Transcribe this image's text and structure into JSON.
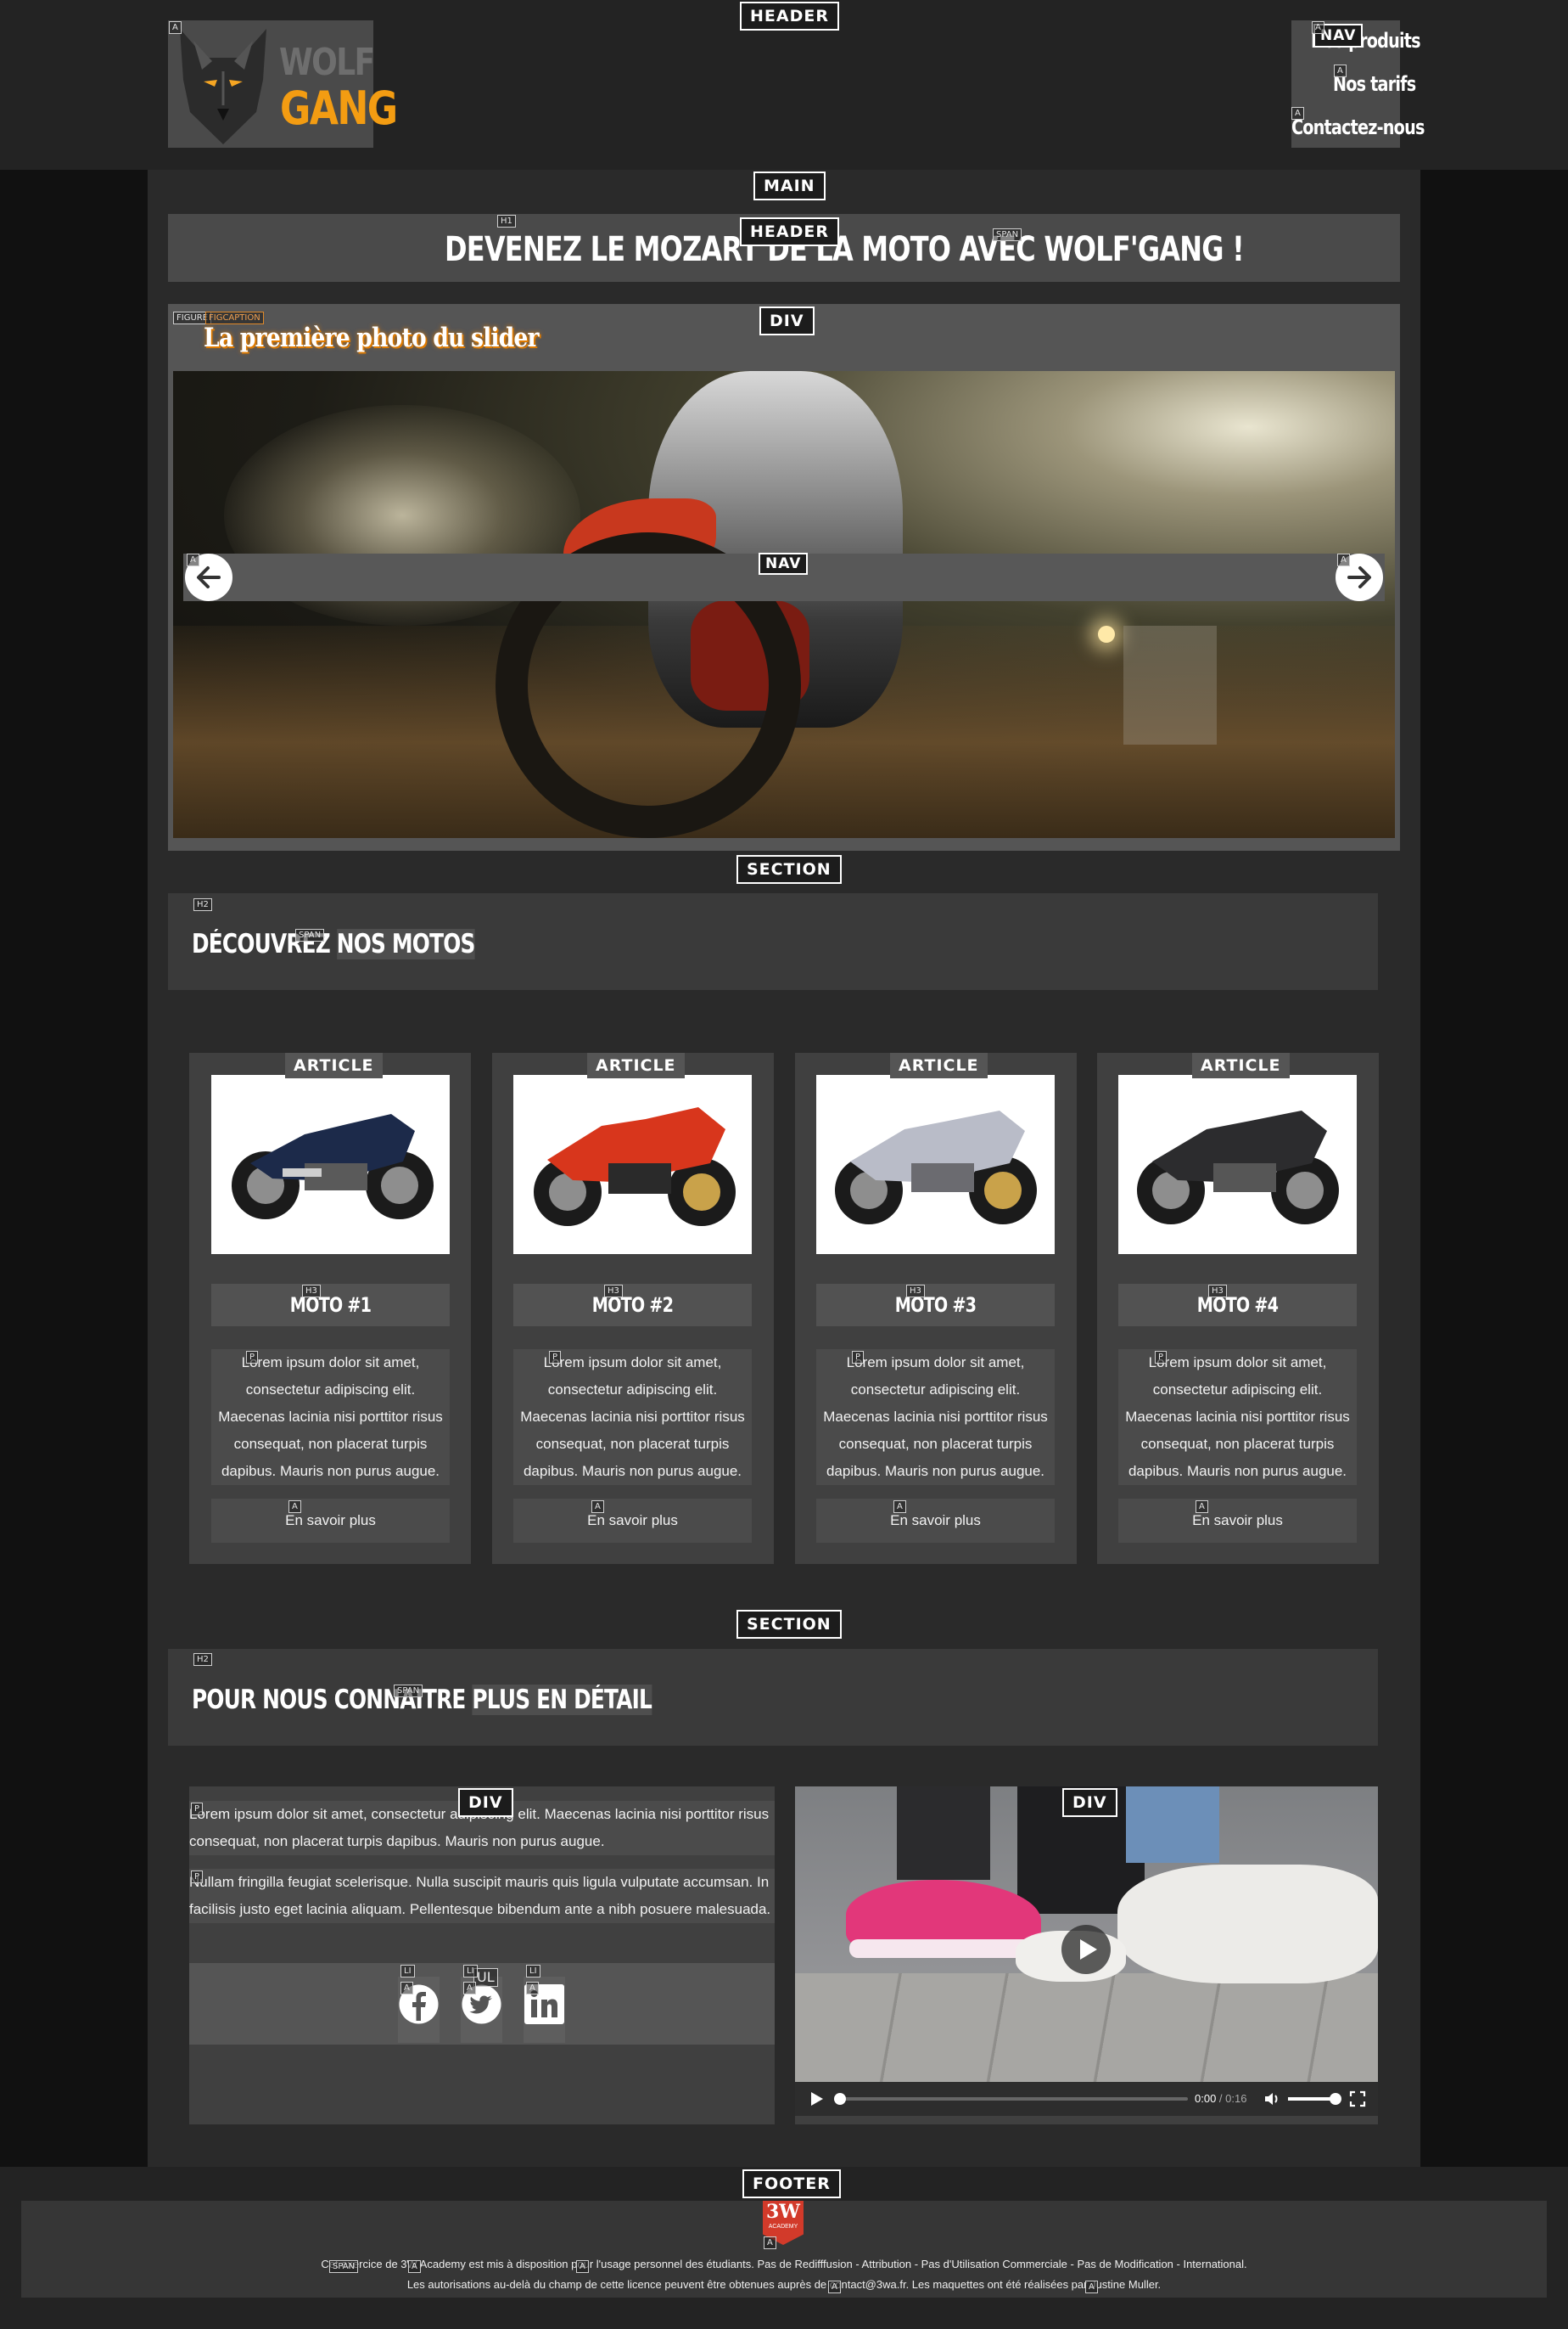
{
  "header": {
    "tag": "HEADER",
    "logo": {
      "tag": "A",
      "word1": "WOLF",
      "word2": "GANG"
    },
    "nav": {
      "tag": "NAV",
      "links": [
        {
          "tag": "A",
          "label": "Nos produits"
        },
        {
          "tag": "A",
          "label": "Nos tarifs"
        },
        {
          "tag": "A",
          "label": "Contactez-nous"
        }
      ]
    }
  },
  "main": {
    "tag": "MAIN",
    "banner": {
      "tag": "HEADER",
      "h1_tag": "H1",
      "span_tag": "SPAN",
      "title": "DEVENEZ LE MOZART DE LA MOTO AVEC WOLF'GANG !"
    },
    "slider": {
      "tag": "DIV",
      "figure_tag": "FIGURE",
      "figcaption_tag": "FIGCAPTION",
      "caption": "La première photo du slider",
      "nav_tag": "NAV",
      "prev_tag": "A",
      "next_tag": "A"
    },
    "motos_section": {
      "tag": "SECTION",
      "h2_tag": "H2",
      "span_tag": "SPAN",
      "heading_before": "DÉCOUVREZ ",
      "heading_span": "NOS MOTOS",
      "articles": [
        {
          "tag": "ARTICLE",
          "h3_tag": "H3",
          "p_tag": "P",
          "a_tag": "A",
          "title": "MOTO #1",
          "text": "Lorem ipsum dolor sit amet, consectetur adipiscing elit. Maecenas lacinia nisi porttitor risus consequat, non placerat turpis dapibus. Mauris non purus augue.",
          "link": "En savoir plus",
          "color": "#1c2a4a"
        },
        {
          "tag": "ARTICLE",
          "h3_tag": "H3",
          "p_tag": "P",
          "a_tag": "A",
          "title": "MOTO #2",
          "text": "Lorem ipsum dolor sit amet, consectetur adipiscing elit. Maecenas lacinia nisi porttitor risus consequat, non placerat turpis dapibus. Mauris non purus augue.",
          "link": "En savoir plus",
          "color": "#d8361c"
        },
        {
          "tag": "ARTICLE",
          "h3_tag": "H3",
          "p_tag": "P",
          "a_tag": "A",
          "title": "MOTO #3",
          "text": "Lorem ipsum dolor sit amet, consectetur adipiscing elit. Maecenas lacinia nisi porttitor risus consequat, non placerat turpis dapibus. Mauris non purus augue.",
          "link": "En savoir plus",
          "color": "#b9bcc8"
        },
        {
          "tag": "ARTICLE",
          "h3_tag": "H3",
          "p_tag": "P",
          "a_tag": "A",
          "title": "MOTO #4",
          "text": "Lorem ipsum dolor sit amet, consectetur adipiscing elit. Maecenas lacinia nisi porttitor risus consequat, non placerat turpis dapibus. Mauris non purus augue.",
          "link": "En savoir plus",
          "color": "#2c2c2e"
        }
      ]
    },
    "about_section": {
      "tag": "SECTION",
      "h2_tag": "H2",
      "span_tag": "SPAN",
      "heading_before": "POUR NOUS CONNAITRE ",
      "heading_span": "PLUS EN DÉTAIL",
      "text_div_tag": "DIV",
      "p_tag": "P",
      "p1": "Lorem ipsum dolor sit amet, consectetur adipiscing elit. Maecenas lacinia nisi porttitor risus consequat, non placerat turpis dapibus. Mauris non purus augue.",
      "p2": "Nullam fringilla feugiat scelerisque. Nulla suscipit mauris quis ligula vulputate accumsan. In facilisis justo eget lacinia aliquam. Pellentesque bibendum ante a nibh posuere malesuada.",
      "ul_tag": "UL",
      "li_tag": "LI",
      "a_tag": "A",
      "socials": [
        "facebook-icon",
        "twitter-icon",
        "linkedin-icon"
      ],
      "video_div_tag": "DIV",
      "video": {
        "current": "0:00",
        "sep": " / ",
        "duration": "0:16",
        "progress": 0,
        "volume": 1.0
      }
    }
  },
  "footer": {
    "tag": "FOOTER",
    "logo_line1": "3W",
    "logo_line2": "ACADEMY",
    "line1": "Cet exercice de 3W Academy est mis à disposition pour l'usage personnel des étudiants. Pas de Redifffusion - Attribution - Pas d'Utilisation Commerciale - Pas de Modification - International.",
    "line2": "Les autorisations au-delà du champ de cette licence peuvent être obtenues auprès de contact@3wa.fr. Les maquettes ont été réalisées par Justine Muller.",
    "span_tag": "SPAN",
    "a_tag": "A",
    "p_tag": "P"
  },
  "colors": {
    "accent": "#f39c12",
    "page_bg": "#111111",
    "container_bg": "#2a2a2a"
  }
}
